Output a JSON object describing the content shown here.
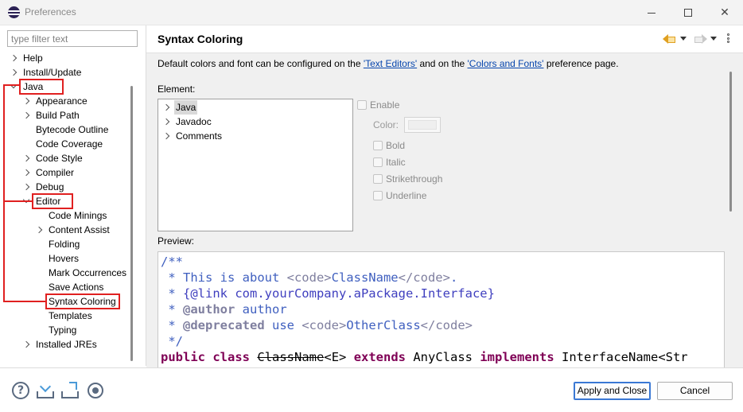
{
  "window": {
    "title": "Preferences",
    "minimize_icon": "minimize-icon",
    "maximize_icon": "maximize-icon",
    "close_glyph": "✕"
  },
  "filter": {
    "placeholder": "type filter text",
    "value": ""
  },
  "tree": {
    "items": [
      {
        "label": "Help",
        "depth": 0,
        "expander": "collapsed"
      },
      {
        "label": "Install/Update",
        "depth": 0,
        "expander": "collapsed"
      },
      {
        "label": "Java",
        "depth": 0,
        "expander": "expanded",
        "highlighted": true
      },
      {
        "label": "Appearance",
        "depth": 1,
        "expander": "collapsed"
      },
      {
        "label": "Build Path",
        "depth": 1,
        "expander": "collapsed"
      },
      {
        "label": "Bytecode Outline",
        "depth": 1,
        "expander": "none"
      },
      {
        "label": "Code Coverage",
        "depth": 1,
        "expander": "none"
      },
      {
        "label": "Code Style",
        "depth": 1,
        "expander": "collapsed"
      },
      {
        "label": "Compiler",
        "depth": 1,
        "expander": "collapsed"
      },
      {
        "label": "Debug",
        "depth": 1,
        "expander": "collapsed"
      },
      {
        "label": "Editor",
        "depth": 1,
        "expander": "expanded",
        "highlighted": true
      },
      {
        "label": "Code Minings",
        "depth": 2,
        "expander": "none"
      },
      {
        "label": "Content Assist",
        "depth": 2,
        "expander": "collapsed"
      },
      {
        "label": "Folding",
        "depth": 2,
        "expander": "none"
      },
      {
        "label": "Hovers",
        "depth": 2,
        "expander": "none"
      },
      {
        "label": "Mark Occurrences",
        "depth": 2,
        "expander": "none"
      },
      {
        "label": "Save Actions",
        "depth": 2,
        "expander": "none"
      },
      {
        "label": "Syntax Coloring",
        "depth": 2,
        "expander": "none",
        "highlighted": true,
        "selected": true
      },
      {
        "label": "Templates",
        "depth": 2,
        "expander": "none"
      },
      {
        "label": "Typing",
        "depth": 2,
        "expander": "none"
      },
      {
        "label": "Installed JREs",
        "depth": 1,
        "expander": "collapsed"
      }
    ],
    "highlight_color": "#e02020"
  },
  "page": {
    "title": "Syntax Coloring",
    "description_prefix": "Default colors and font can be configured on the ",
    "link1": "'Text Editors'",
    "description_middle": " and on the ",
    "link2": "'Colors and Fonts'",
    "description_suffix": " preference page.",
    "element_label": "Element:",
    "elements": [
      {
        "label": "Java",
        "selected": true
      },
      {
        "label": "Javadoc",
        "selected": false
      },
      {
        "label": "Comments",
        "selected": false
      }
    ],
    "enable_label": "Enable",
    "color_label": "Color:",
    "bold_label": "Bold",
    "italic_label": "Italic",
    "strikethrough_label": "Strikethrough",
    "underline_label": "Underline",
    "preview_label": "Preview:"
  },
  "preview_code": {
    "line1": "/**",
    "line2_a": " * This is about ",
    "line2_tag1": "<code>",
    "line2_b": "ClassName",
    "line2_tag2": "</code>",
    "line2_c": ".",
    "line3_a": " * ",
    "line3_b": "{@link com.yourCompany.aPackage.Interface}",
    "line4_a": " * ",
    "line4_kw": "@author",
    "line4_b": " author",
    "line5_a": " * ",
    "line5_kw": "@deprecated",
    "line5_b": " use ",
    "line5_tag1": "<code>",
    "line5_c": "OtherClass",
    "line5_tag2": "</code>",
    "line6": " */",
    "line7_kw1": "public",
    "line7_sp1": " ",
    "line7_kw2": "class",
    "line7_sp2": " ",
    "line7_cls": "ClassName",
    "line7_gen": "<E> ",
    "line7_kw3": "extends",
    "line7_mid": " AnyClass ",
    "line7_kw4": "implements",
    "line7_end": " InterfaceName<Str"
  },
  "footer": {
    "help_icon": "help-icon",
    "help_glyph": "?",
    "import_icon": "import-icon",
    "export_icon": "export-icon",
    "record_icon": "record-icon",
    "apply_close_label": "Apply and Close",
    "cancel_label": "Cancel"
  },
  "colors": {
    "keyword": "#7f0055",
    "javadoc": "#3f5fbf",
    "link": "#0645ad",
    "default_button_border": "#3a78d4"
  }
}
